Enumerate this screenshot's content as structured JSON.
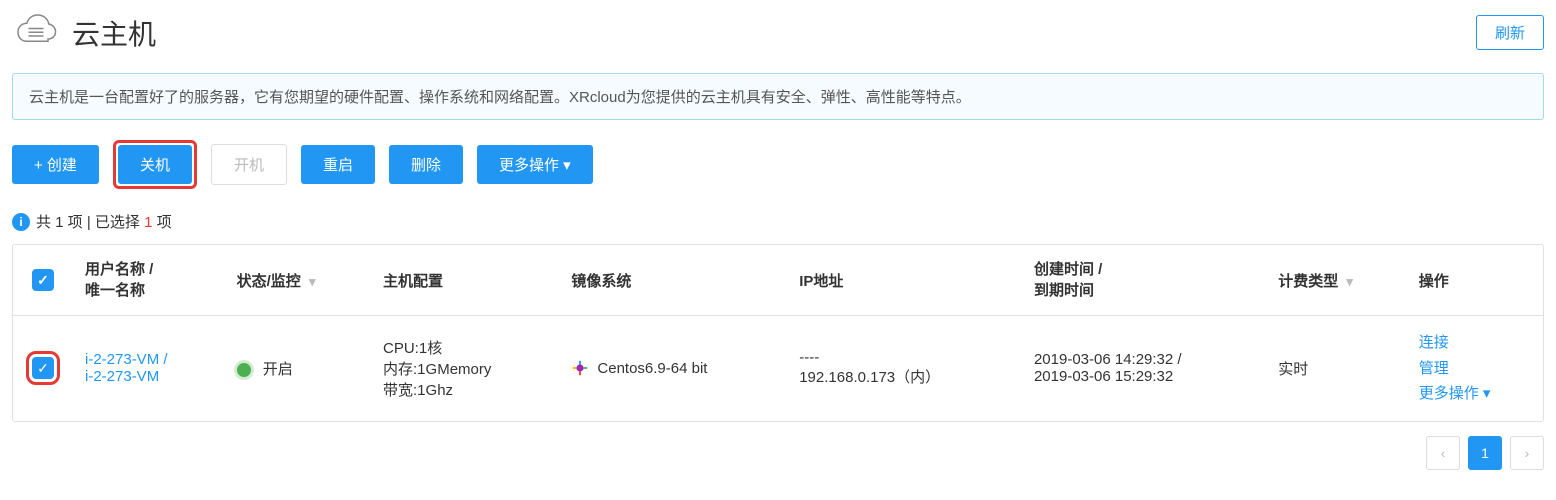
{
  "header": {
    "title": "云主机",
    "refresh_label": "刷新"
  },
  "banner": {
    "text": "云主机是一台配置好了的服务器，它有您期望的硬件配置、操作系统和网络配置。XRcloud为您提供的云主机具有安全、弹性、高性能等特点。"
  },
  "toolbar": {
    "create_label": "+ 创建",
    "shutdown_label": "关机",
    "poweron_label": "开机",
    "restart_label": "重启",
    "delete_label": "删除",
    "more_label": "更多操作"
  },
  "summary": {
    "prefix": "共 ",
    "total": "1",
    "mid": " 项 | 已选择 ",
    "selected": "1",
    "suffix": " 项"
  },
  "table": {
    "headers": {
      "name": "用户名称 /\n唯一名称",
      "status": "状态/监控",
      "config": "主机配置",
      "image": "镜像系统",
      "ip": "IP地址",
      "time": "创建时间 /\n到期时间",
      "billing": "计费类型",
      "action": "操作"
    },
    "rows": [
      {
        "name_line1": "i-2-273-VM /",
        "name_line2": "i-2-273-VM",
        "status_text": "开启",
        "config_cpu": "CPU:1核",
        "config_mem": "内存:1GMemory",
        "config_bw": "带宽:1Ghz",
        "image": "Centos6.9-64 bit",
        "ip_line1": "----",
        "ip_line2": "192.168.0.173（内）",
        "time_line1": "2019-03-06 14:29:32 /",
        "time_line2": "2019-03-06 15:29:32",
        "billing": "实时",
        "action_connect": "连接",
        "action_manage": "管理",
        "action_more": "更多操作"
      }
    ]
  },
  "pagination": {
    "current": "1"
  }
}
